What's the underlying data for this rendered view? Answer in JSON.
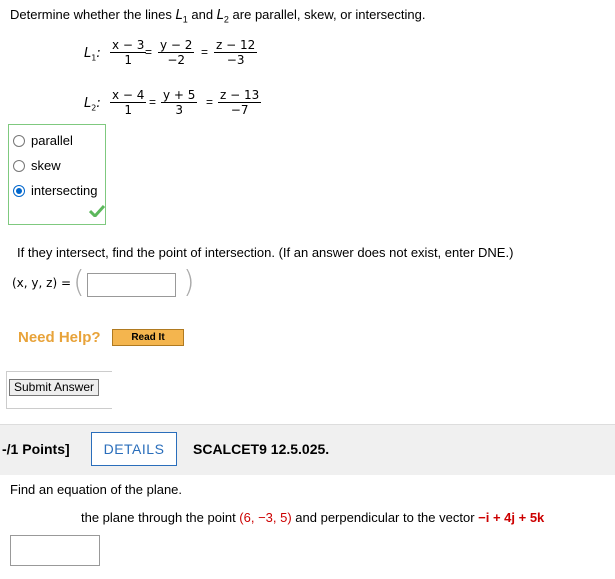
{
  "question": {
    "prefix": "Determine whether the lines ",
    "l1": "L",
    "l1_sub": "1",
    "and": " and ",
    "l2": "L",
    "l2_sub": "2",
    "suffix": " are parallel, skew, or intersecting."
  },
  "line1": {
    "label": "L",
    "sub": "1",
    "colon": ":",
    "x_num": "x − 3",
    "x_den": "1",
    "y_num": "y − 2",
    "y_den": "−2",
    "z_num": "z − 12",
    "z_den": "−3",
    "eq": "="
  },
  "line2": {
    "label": "L",
    "sub": "2",
    "colon": ":",
    "x_num": "x − 4",
    "x_den": "1",
    "y_num": "y + 5",
    "y_den": "3",
    "z_num": "z − 13",
    "z_den": "−7",
    "eq": "="
  },
  "choices": [
    {
      "label": "parallel",
      "selected": false
    },
    {
      "label": "skew",
      "selected": false
    },
    {
      "label": "intersecting",
      "selected": true
    }
  ],
  "correct_icon": "checkmark-icon",
  "accent_green": "#5cb85c",
  "sub_question": "If they intersect, find the point of intersection. (If an answer does not exist, enter DNE.)",
  "xyz_label": "(x, y, z) =",
  "answer_value": "",
  "need_help": "Need Help?",
  "read_it": "Read It",
  "submit": "Submit Answer",
  "next": {
    "points": "-/1 Points]",
    "details": "DETAILS",
    "code": "SCALCET9 12.5.025.",
    "prompt": "Find an equation of the plane.",
    "desc_pre": "the plane through the point ",
    "point": "(6, −3, 5)",
    "desc_mid": " and perpendicular to the vector ",
    "vector": "−i + 4j + 5k",
    "answer_value": ""
  }
}
